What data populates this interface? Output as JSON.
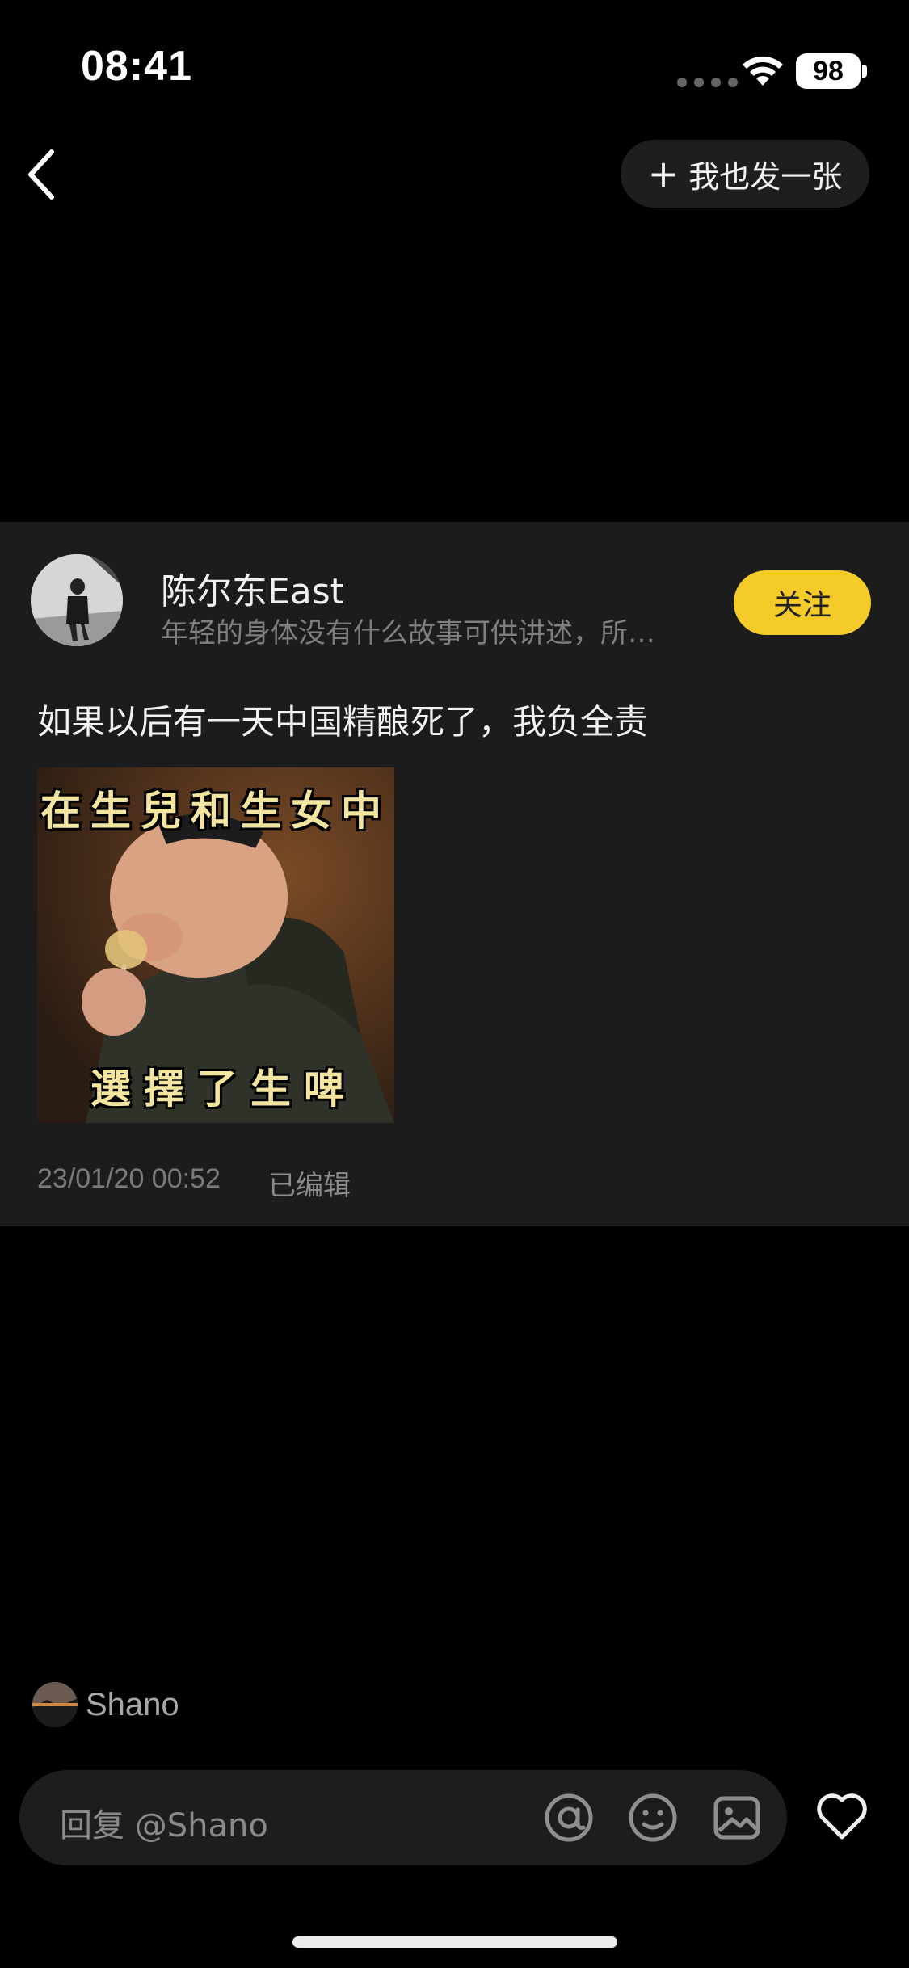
{
  "status_bar": {
    "time": "08:41",
    "battery": "98"
  },
  "nav": {
    "post_label": "我也发一张"
  },
  "post": {
    "author_name": "陈尔东East",
    "author_bio": "年轻的身体没有什么故事可供讲述，所…",
    "follow_label": "关注",
    "text": "如果以后有一天中国精酿死了，我负全责",
    "image_caption_top": "在生兒和生女中",
    "image_caption_bottom": "選擇了生啤",
    "timestamp": "23/01/20 00:52",
    "edited_label": "已编辑"
  },
  "reply": {
    "user_name": "Shano",
    "placeholder": "回复 @Shano"
  },
  "colors": {
    "background": "#000000",
    "card": "#1c1c1c",
    "accent": "#f5cb2a"
  },
  "icons": [
    "chevron-left-icon",
    "plus-icon",
    "wifi-icon",
    "at-icon",
    "emoji-icon",
    "image-icon",
    "heart-icon"
  ]
}
